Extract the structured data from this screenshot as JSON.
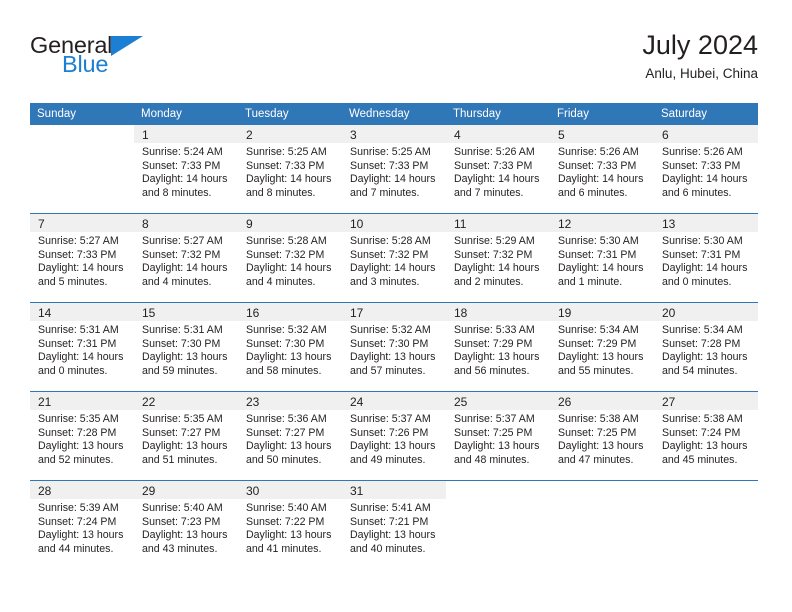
{
  "logo": {
    "word1": "General",
    "word2": "Blue",
    "triangle_color": "#1b7fd4",
    "word1_color": "#231f20",
    "word2_color": "#1b7fd4"
  },
  "header": {
    "title": "July 2024",
    "subtitle": "Anlu, Hubei, China"
  },
  "theme": {
    "header_bg": "#3077b8",
    "header_text": "#ffffff",
    "daynum_bg": "#f0f0f0",
    "row_divider": "#3077b8",
    "body_text": "#231f20"
  },
  "weekday_headers": [
    "Sunday",
    "Monday",
    "Tuesday",
    "Wednesday",
    "Thursday",
    "Friday",
    "Saturday"
  ],
  "labels": {
    "sunrise_prefix": "Sunrise:",
    "sunset_prefix": "Sunset:",
    "daylight_prefix": "Daylight:"
  },
  "weeks": [
    [
      {
        "day": "",
        "blank": true,
        "sunrise": "",
        "sunset": "",
        "daylight_line1": "",
        "daylight_line2": ""
      },
      {
        "day": "1",
        "blank": false,
        "sunrise": "Sunrise: 5:24 AM",
        "sunset": "Sunset: 7:33 PM",
        "daylight_line1": "Daylight: 14 hours",
        "daylight_line2": "and 8 minutes."
      },
      {
        "day": "2",
        "blank": false,
        "sunrise": "Sunrise: 5:25 AM",
        "sunset": "Sunset: 7:33 PM",
        "daylight_line1": "Daylight: 14 hours",
        "daylight_line2": "and 8 minutes."
      },
      {
        "day": "3",
        "blank": false,
        "sunrise": "Sunrise: 5:25 AM",
        "sunset": "Sunset: 7:33 PM",
        "daylight_line1": "Daylight: 14 hours",
        "daylight_line2": "and 7 minutes."
      },
      {
        "day": "4",
        "blank": false,
        "sunrise": "Sunrise: 5:26 AM",
        "sunset": "Sunset: 7:33 PM",
        "daylight_line1": "Daylight: 14 hours",
        "daylight_line2": "and 7 minutes."
      },
      {
        "day": "5",
        "blank": false,
        "sunrise": "Sunrise: 5:26 AM",
        "sunset": "Sunset: 7:33 PM",
        "daylight_line1": "Daylight: 14 hours",
        "daylight_line2": "and 6 minutes."
      },
      {
        "day": "6",
        "blank": false,
        "sunrise": "Sunrise: 5:26 AM",
        "sunset": "Sunset: 7:33 PM",
        "daylight_line1": "Daylight: 14 hours",
        "daylight_line2": "and 6 minutes."
      }
    ],
    [
      {
        "day": "7",
        "blank": false,
        "sunrise": "Sunrise: 5:27 AM",
        "sunset": "Sunset: 7:33 PM",
        "daylight_line1": "Daylight: 14 hours",
        "daylight_line2": "and 5 minutes."
      },
      {
        "day": "8",
        "blank": false,
        "sunrise": "Sunrise: 5:27 AM",
        "sunset": "Sunset: 7:32 PM",
        "daylight_line1": "Daylight: 14 hours",
        "daylight_line2": "and 4 minutes."
      },
      {
        "day": "9",
        "blank": false,
        "sunrise": "Sunrise: 5:28 AM",
        "sunset": "Sunset: 7:32 PM",
        "daylight_line1": "Daylight: 14 hours",
        "daylight_line2": "and 4 minutes."
      },
      {
        "day": "10",
        "blank": false,
        "sunrise": "Sunrise: 5:28 AM",
        "sunset": "Sunset: 7:32 PM",
        "daylight_line1": "Daylight: 14 hours",
        "daylight_line2": "and 3 minutes."
      },
      {
        "day": "11",
        "blank": false,
        "sunrise": "Sunrise: 5:29 AM",
        "sunset": "Sunset: 7:32 PM",
        "daylight_line1": "Daylight: 14 hours",
        "daylight_line2": "and 2 minutes."
      },
      {
        "day": "12",
        "blank": false,
        "sunrise": "Sunrise: 5:30 AM",
        "sunset": "Sunset: 7:31 PM",
        "daylight_line1": "Daylight: 14 hours",
        "daylight_line2": "and 1 minute."
      },
      {
        "day": "13",
        "blank": false,
        "sunrise": "Sunrise: 5:30 AM",
        "sunset": "Sunset: 7:31 PM",
        "daylight_line1": "Daylight: 14 hours",
        "daylight_line2": "and 0 minutes."
      }
    ],
    [
      {
        "day": "14",
        "blank": false,
        "sunrise": "Sunrise: 5:31 AM",
        "sunset": "Sunset: 7:31 PM",
        "daylight_line1": "Daylight: 14 hours",
        "daylight_line2": "and 0 minutes."
      },
      {
        "day": "15",
        "blank": false,
        "sunrise": "Sunrise: 5:31 AM",
        "sunset": "Sunset: 7:30 PM",
        "daylight_line1": "Daylight: 13 hours",
        "daylight_line2": "and 59 minutes."
      },
      {
        "day": "16",
        "blank": false,
        "sunrise": "Sunrise: 5:32 AM",
        "sunset": "Sunset: 7:30 PM",
        "daylight_line1": "Daylight: 13 hours",
        "daylight_line2": "and 58 minutes."
      },
      {
        "day": "17",
        "blank": false,
        "sunrise": "Sunrise: 5:32 AM",
        "sunset": "Sunset: 7:30 PM",
        "daylight_line1": "Daylight: 13 hours",
        "daylight_line2": "and 57 minutes."
      },
      {
        "day": "18",
        "blank": false,
        "sunrise": "Sunrise: 5:33 AM",
        "sunset": "Sunset: 7:29 PM",
        "daylight_line1": "Daylight: 13 hours",
        "daylight_line2": "and 56 minutes."
      },
      {
        "day": "19",
        "blank": false,
        "sunrise": "Sunrise: 5:34 AM",
        "sunset": "Sunset: 7:29 PM",
        "daylight_line1": "Daylight: 13 hours",
        "daylight_line2": "and 55 minutes."
      },
      {
        "day": "20",
        "blank": false,
        "sunrise": "Sunrise: 5:34 AM",
        "sunset": "Sunset: 7:28 PM",
        "daylight_line1": "Daylight: 13 hours",
        "daylight_line2": "and 54 minutes."
      }
    ],
    [
      {
        "day": "21",
        "blank": false,
        "sunrise": "Sunrise: 5:35 AM",
        "sunset": "Sunset: 7:28 PM",
        "daylight_line1": "Daylight: 13 hours",
        "daylight_line2": "and 52 minutes."
      },
      {
        "day": "22",
        "blank": false,
        "sunrise": "Sunrise: 5:35 AM",
        "sunset": "Sunset: 7:27 PM",
        "daylight_line1": "Daylight: 13 hours",
        "daylight_line2": "and 51 minutes."
      },
      {
        "day": "23",
        "blank": false,
        "sunrise": "Sunrise: 5:36 AM",
        "sunset": "Sunset: 7:27 PM",
        "daylight_line1": "Daylight: 13 hours",
        "daylight_line2": "and 50 minutes."
      },
      {
        "day": "24",
        "blank": false,
        "sunrise": "Sunrise: 5:37 AM",
        "sunset": "Sunset: 7:26 PM",
        "daylight_line1": "Daylight: 13 hours",
        "daylight_line2": "and 49 minutes."
      },
      {
        "day": "25",
        "blank": false,
        "sunrise": "Sunrise: 5:37 AM",
        "sunset": "Sunset: 7:25 PM",
        "daylight_line1": "Daylight: 13 hours",
        "daylight_line2": "and 48 minutes."
      },
      {
        "day": "26",
        "blank": false,
        "sunrise": "Sunrise: 5:38 AM",
        "sunset": "Sunset: 7:25 PM",
        "daylight_line1": "Daylight: 13 hours",
        "daylight_line2": "and 47 minutes."
      },
      {
        "day": "27",
        "blank": false,
        "sunrise": "Sunrise: 5:38 AM",
        "sunset": "Sunset: 7:24 PM",
        "daylight_line1": "Daylight: 13 hours",
        "daylight_line2": "and 45 minutes."
      }
    ],
    [
      {
        "day": "28",
        "blank": false,
        "sunrise": "Sunrise: 5:39 AM",
        "sunset": "Sunset: 7:24 PM",
        "daylight_line1": "Daylight: 13 hours",
        "daylight_line2": "and 44 minutes."
      },
      {
        "day": "29",
        "blank": false,
        "sunrise": "Sunrise: 5:40 AM",
        "sunset": "Sunset: 7:23 PM",
        "daylight_line1": "Daylight: 13 hours",
        "daylight_line2": "and 43 minutes."
      },
      {
        "day": "30",
        "blank": false,
        "sunrise": "Sunrise: 5:40 AM",
        "sunset": "Sunset: 7:22 PM",
        "daylight_line1": "Daylight: 13 hours",
        "daylight_line2": "and 41 minutes."
      },
      {
        "day": "31",
        "blank": false,
        "sunrise": "Sunrise: 5:41 AM",
        "sunset": "Sunset: 7:21 PM",
        "daylight_line1": "Daylight: 13 hours",
        "daylight_line2": "and 40 minutes."
      },
      {
        "day": "",
        "blank": true,
        "sunrise": "",
        "sunset": "",
        "daylight_line1": "",
        "daylight_line2": ""
      },
      {
        "day": "",
        "blank": true,
        "sunrise": "",
        "sunset": "",
        "daylight_line1": "",
        "daylight_line2": ""
      },
      {
        "day": "",
        "blank": true,
        "sunrise": "",
        "sunset": "",
        "daylight_line1": "",
        "daylight_line2": ""
      }
    ]
  ]
}
